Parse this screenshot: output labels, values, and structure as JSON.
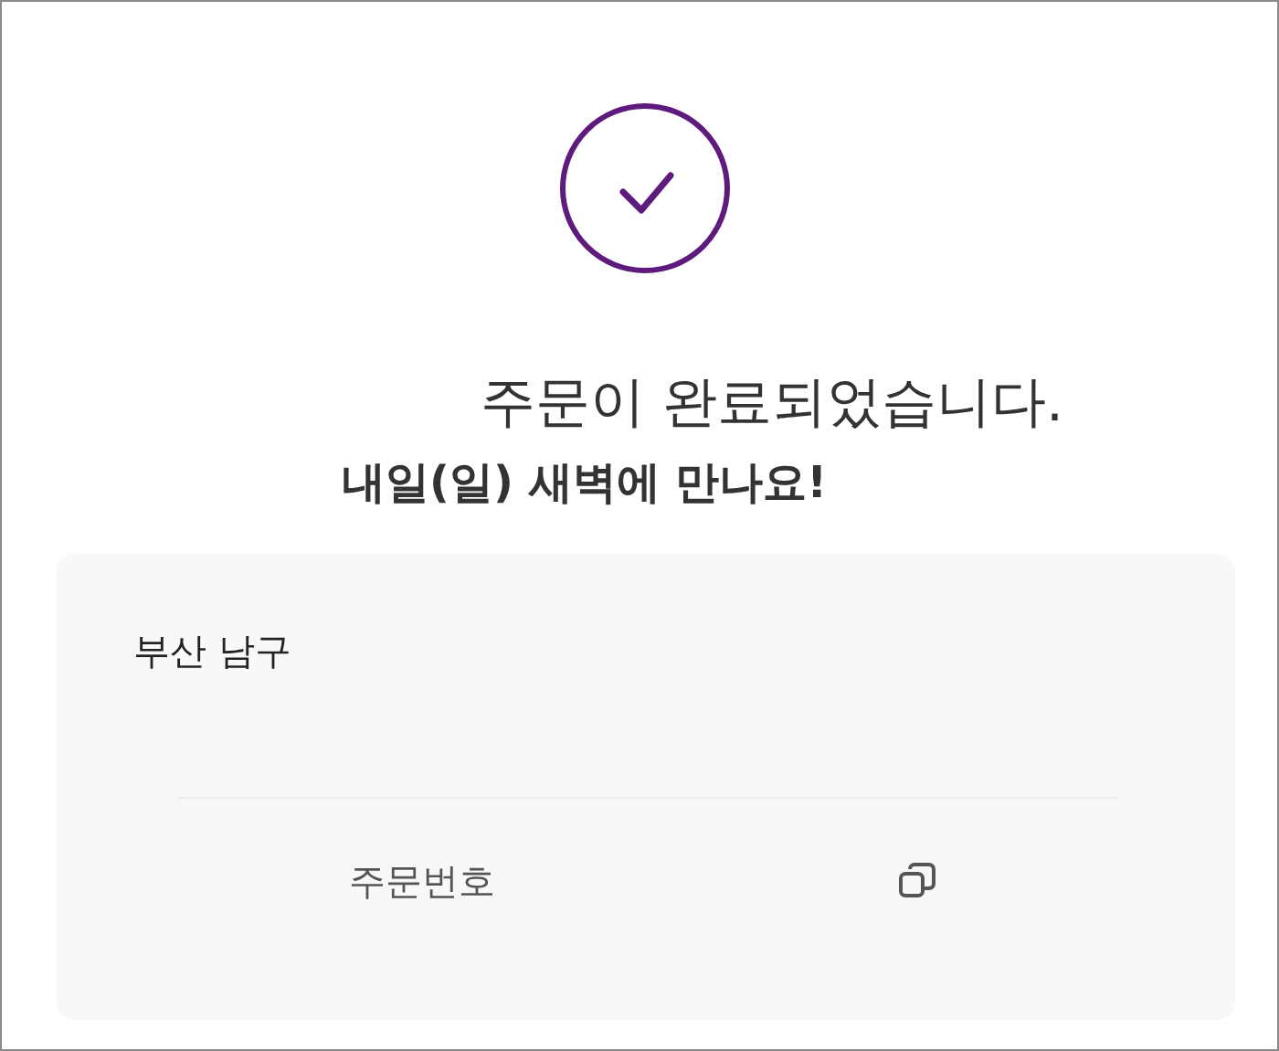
{
  "status_icon": {
    "kind": "check"
  },
  "title": "주문이 완료되었습니다.",
  "subtitle": "내일(일) 새벽에 만나요!",
  "card": {
    "address": "부산 남구",
    "order_label": "주문번호"
  }
}
